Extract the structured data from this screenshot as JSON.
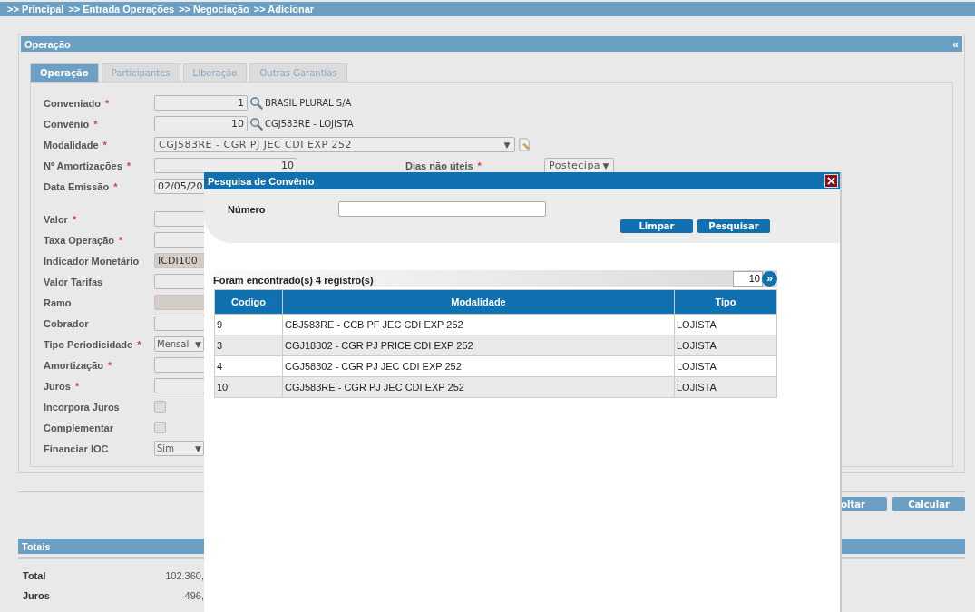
{
  "breadcrumb": [
    ">> Principal",
    ">> Entrada Operações",
    ">> Negociação",
    ">> Adicionar"
  ],
  "panel": {
    "title": "Operação",
    "collapse_icon": "«"
  },
  "required_mark": "*",
  "select_caret": "▼",
  "tabs": [
    {
      "label": "Operação",
      "selected": true
    },
    {
      "label": "Participantes",
      "selected": false
    },
    {
      "label": "Liberação",
      "selected": false
    },
    {
      "label": "Outras Garantias",
      "selected": false
    }
  ],
  "fields_top": [
    {
      "label": "Conveniado",
      "required": true,
      "kind": "lookup",
      "value": "1",
      "description": "BRASIL PLURAL S/A"
    },
    {
      "label": "Convênio",
      "required": true,
      "kind": "lookup",
      "value": "10",
      "description": "CGJ583RE - LOJISTA"
    },
    {
      "label": "Modalidade",
      "required": true,
      "kind": "wide-select",
      "value": "CGJ583RE - CGR PJ JEC CDI EXP 252",
      "disabled": true
    },
    {
      "label": "Nº Amortizações",
      "required": true,
      "kind": "number",
      "value": "10",
      "side_field": {
        "label": "Dias não úteis",
        "required": true,
        "value": "Postecipa"
      }
    },
    {
      "label": "Data Emissão",
      "required": true,
      "kind": "text",
      "value": "02/05/20",
      "disabled": false
    }
  ],
  "fields": [
    {
      "label": "Valor",
      "required": true,
      "kind": "text",
      "disabled": false
    },
    {
      "label": "Taxa Operação",
      "required": true,
      "kind": "text",
      "disabled": false
    },
    {
      "label": "Indicador Monetário",
      "required": false,
      "kind": "text",
      "value": "ICDI100",
      "disabled": true
    },
    {
      "label": "Valor Tarifas",
      "required": false,
      "kind": "text",
      "disabled": false
    },
    {
      "label": "Ramo",
      "required": false,
      "kind": "text",
      "disabled": true
    },
    {
      "label": "Cobrador",
      "required": false,
      "kind": "text",
      "disabled": false
    },
    {
      "label": "Tipo Periodicidade",
      "required": true,
      "kind": "select",
      "value": "Mensal"
    },
    {
      "label": "Amortização",
      "required": true,
      "kind": "text",
      "disabled": false
    },
    {
      "label": "Juros",
      "required": true,
      "kind": "text",
      "disabled": false
    },
    {
      "label": "Incorpora Juros",
      "required": false,
      "kind": "checkbox",
      "checked": false
    },
    {
      "label": "Complementar",
      "required": false,
      "kind": "checkbox",
      "checked": false
    },
    {
      "label": "Financiar IOC",
      "required": false,
      "kind": "select",
      "value": "Sim"
    }
  ],
  "buttons": [
    "oltar",
    "Calcular"
  ],
  "totals": {
    "title": "Totais",
    "rows": [
      {
        "label": "Total",
        "value": "102.360,"
      },
      {
        "label": "Juros",
        "value": "496,"
      }
    ]
  },
  "modal": {
    "title": "Pesquisa de Convênio",
    "search_label": "Número",
    "buttons": [
      "Limpar",
      "Pesquisar"
    ],
    "result_text": "Foram encontrado(s) 4 registro(s)",
    "page_size": "10",
    "next_icon": "»",
    "columns": [
      "Codigo",
      "Modalidade",
      "Tipo"
    ],
    "rows": [
      [
        "9",
        "CBJ583RE - CCB PF JEC CDI EXP 252",
        "LOJISTA"
      ],
      [
        "3",
        "CGJ18302 - CGR PJ PRICE CDI EXP 252",
        "LOJISTA"
      ],
      [
        "4",
        "CGJ58302 - CGR PJ JEC CDI EXP 252",
        "LOJISTA"
      ],
      [
        "10",
        "CGJ583RE - CGR PJ JEC CDI EXP 252",
        "LOJISTA"
      ]
    ]
  }
}
